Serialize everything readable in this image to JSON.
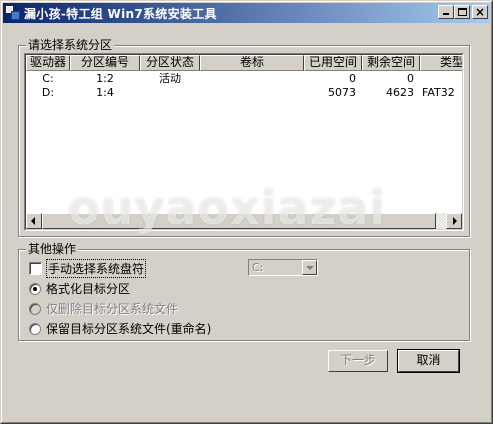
{
  "window": {
    "title": "漏小孩-特工组 Win7系统安装工具",
    "minimize_icon": "minimize-icon",
    "maximize_icon": "maximize-icon",
    "close_icon": "close-icon",
    "close_glyph": "×"
  },
  "partition_group": {
    "label": "请选择系统分区",
    "columns": [
      "驱动器",
      "分区编号",
      "分区状态",
      "卷标",
      "已用空间",
      "剩余空间",
      "类型"
    ],
    "rows": [
      {
        "drive": "C:",
        "number": "1:2",
        "status": "活动",
        "label": "",
        "used": "0",
        "free": "0",
        "type": ""
      },
      {
        "drive": "D:",
        "number": "1:4",
        "status": "",
        "label": "",
        "used": "5073",
        "free": "4623",
        "type": "FAT32"
      }
    ]
  },
  "options_group": {
    "label": "其他操作",
    "manual_select_label": "手动选择系统盘符",
    "manual_select_checked": false,
    "drive_combo_value": "C:",
    "radio_format_label": "格式化目标分区",
    "radio_delete_only_label": "仅删除目标分区系统文件",
    "radio_keep_label": "保留目标分区系统文件(重命名)",
    "selected_option": "format"
  },
  "buttons": {
    "next_label": "下一步",
    "cancel_label": "取消"
  },
  "watermark_text": "ouyaoxiazai",
  "colors": {
    "titlebar_start": "#0a246a",
    "titlebar_end": "#a6caf0",
    "face": "#d4d0c8"
  }
}
